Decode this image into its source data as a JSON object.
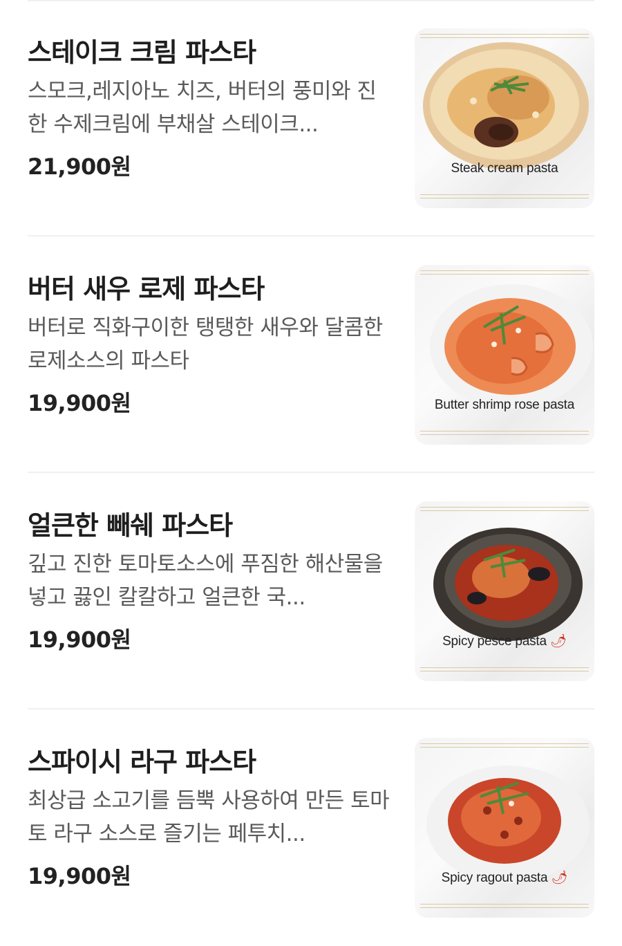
{
  "menu_items": [
    {
      "name": "스테이크 크림 파스타",
      "description": "스모크,레지아노 치즈, 버터의 풍미와 진한 수제크림에 부채살 스테이크...",
      "price": "21,900원",
      "image_caption": "Steak cream pasta",
      "image_icon": "steak-cream-pasta-photo"
    },
    {
      "name": "버터 새우 로제 파스타",
      "description": "버터로 직화구이한 탱탱한 새우와 달콤한 로제소스의 파스타",
      "price": "19,900원",
      "image_caption": "Butter shrimp rose pasta",
      "image_icon": "butter-shrimp-rose-pasta-photo"
    },
    {
      "name": "얼큰한 빼쉐 파스타",
      "description": "깊고 진한 토마토소스에 푸짐한 해산물을 넣고 끓인 칼칼하고 얼큰한 국...",
      "price": "19,900원",
      "image_caption": "Spicy pesce pasta",
      "image_icon": "spicy-pesce-pasta-photo",
      "spicy": true
    },
    {
      "name": "스파이시 라구 파스타",
      "description": "최상급 소고기를 듬뿍 사용하여 만든 토마토 라구 소스로 즐기는 페투치...",
      "price": "19,900원",
      "image_caption": "Spicy ragout pasta",
      "image_icon": "spicy-ragout-pasta-photo",
      "spicy": true
    }
  ],
  "colors": {
    "background": "#ffffff",
    "title": "#1e1e1e",
    "description": "#5a5a5a",
    "divider": "#f0f0f0",
    "chili": "#d62a1e"
  }
}
